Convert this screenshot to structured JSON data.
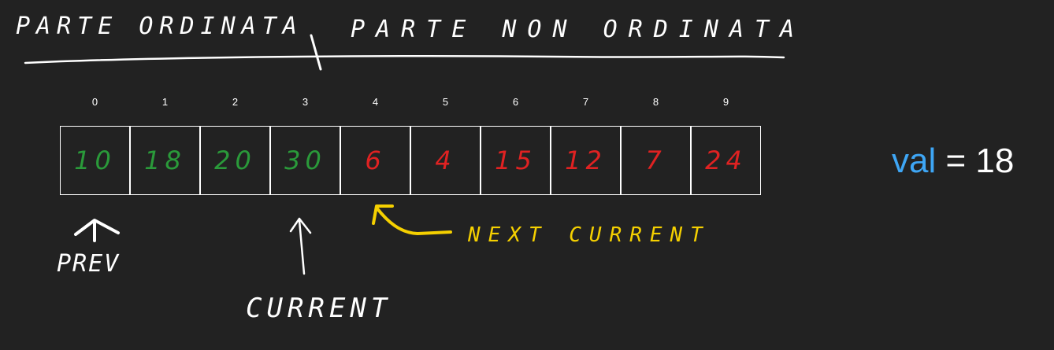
{
  "header": {
    "left_label": "PARTE ORDINATA",
    "right_label": "PARTE NON ORDINATA"
  },
  "array": {
    "indices": [
      "0",
      "1",
      "2",
      "3",
      "4",
      "5",
      "6",
      "7",
      "8",
      "9"
    ],
    "cells": [
      {
        "value": "10",
        "color": "#2a9a3a"
      },
      {
        "value": "18",
        "color": "#2a9a3a"
      },
      {
        "value": "20",
        "color": "#2a9a3a"
      },
      {
        "value": "30",
        "color": "#2a9a3a"
      },
      {
        "value": "6",
        "color": "#e02222"
      },
      {
        "value": "4",
        "color": "#e02222"
      },
      {
        "value": "15",
        "color": "#e02222"
      },
      {
        "value": "12",
        "color": "#e02222"
      },
      {
        "value": "7",
        "color": "#e02222"
      },
      {
        "value": "24",
        "color": "#e02222"
      }
    ]
  },
  "variable": {
    "name": "val",
    "equals": "=",
    "value": "18",
    "name_color": "#3ea6f5"
  },
  "pointers": {
    "prev": "PREV",
    "current": "CURRENT",
    "next_current": "NEXT CURRENT",
    "next_color": "#f5d000"
  },
  "colors": {
    "background": "#222222",
    "sorted": "#2a9a3a",
    "unsorted": "#e02222",
    "ink": "#ffffff"
  }
}
